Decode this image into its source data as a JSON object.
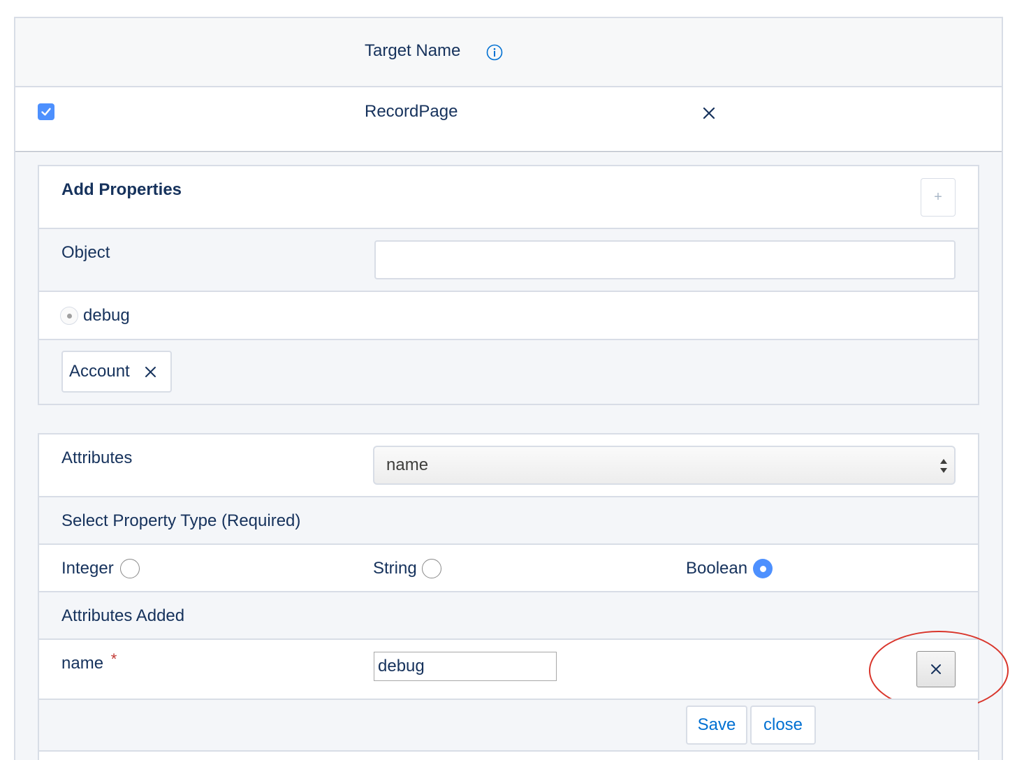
{
  "header": {
    "target_name_label": "Target Name"
  },
  "target_row": {
    "checked": true,
    "target": "RecordPage",
    "remove_icon": "close-icon"
  },
  "add_properties": {
    "title": "Add Properties",
    "add_button_label": "+",
    "object_label": "Object",
    "object_value": "",
    "debug_option_label": "debug",
    "object_pill_label": "Account"
  },
  "attributes": {
    "label": "Attributes",
    "selected": "name",
    "select_property_type_label": "Select Property Type (Required)",
    "types": [
      {
        "label": "Integer",
        "selected": false
      },
      {
        "label": "String",
        "selected": false
      },
      {
        "label": "Boolean",
        "selected": true
      }
    ],
    "attributes_added_label": "Attributes Added",
    "added": [
      {
        "name": "name",
        "required_marker": "*",
        "value": "debug"
      }
    ]
  },
  "footer": {
    "save_label": "Save",
    "close_label": "close"
  },
  "colors": {
    "accent": "#4d90fe",
    "link": "#0070d2",
    "annotation": "#d9352b"
  }
}
